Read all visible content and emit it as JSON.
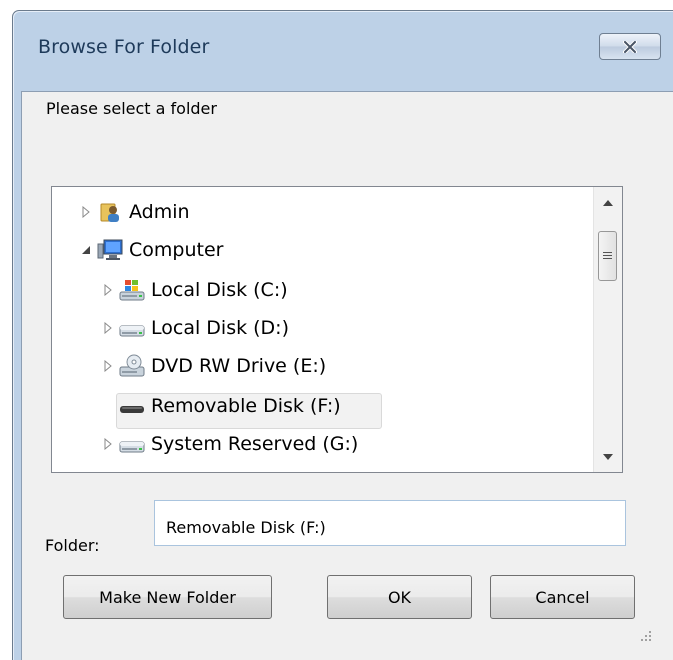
{
  "window": {
    "title": "Browse For Folder",
    "prompt": "Please select a folder"
  },
  "tree": {
    "items": [
      {
        "label": "Admin",
        "icon": "user-folder-icon",
        "expander": "collapsed"
      },
      {
        "label": "Computer",
        "icon": "computer-icon",
        "expander": "expanded"
      },
      {
        "label": "Local Disk (C:)",
        "icon": "windows-drive-icon",
        "expander": "collapsed"
      },
      {
        "label": "Local Disk (D:)",
        "icon": "hard-drive-icon",
        "expander": "collapsed"
      },
      {
        "label": "DVD RW Drive (E:)",
        "icon": "dvd-drive-icon",
        "expander": "collapsed"
      },
      {
        "label": "Removable Disk (F:)",
        "icon": "removable-disk-icon",
        "expander": "none",
        "selected": true
      },
      {
        "label": "System Reserved (G:)",
        "icon": "hard-drive-icon",
        "expander": "collapsed"
      }
    ]
  },
  "folder": {
    "label": "Folder:",
    "value": "Removable Disk (F:)"
  },
  "buttons": {
    "make_new_folder": "Make New Folder",
    "ok": "OK",
    "cancel": "Cancel"
  },
  "colors": {
    "frame": "#bdd1e7",
    "client": "#f0f0f0",
    "selection": "#f2f2f2"
  }
}
